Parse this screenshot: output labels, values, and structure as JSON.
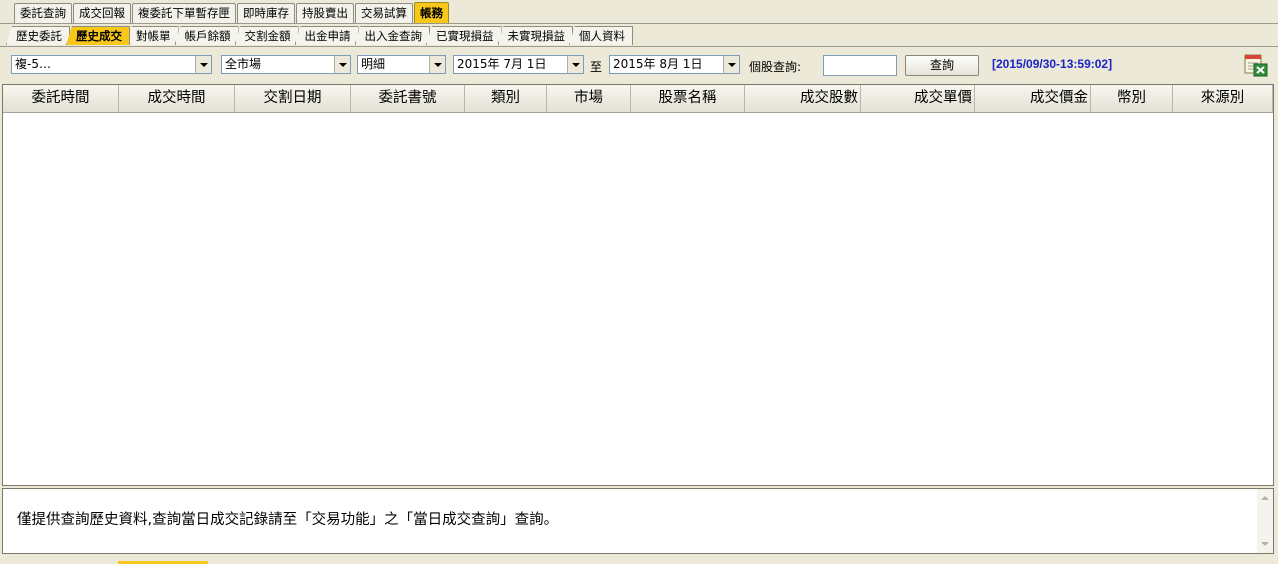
{
  "top_tabs": [
    {
      "label": "委託查詢",
      "active": false
    },
    {
      "label": "成交回報",
      "active": false
    },
    {
      "label": "複委託下單暫存匣",
      "active": false
    },
    {
      "label": "即時庫存",
      "active": false
    },
    {
      "label": "持股賣出",
      "active": false
    },
    {
      "label": "交易試算",
      "active": false
    },
    {
      "label": "帳務",
      "active": true
    }
  ],
  "sub_tabs": [
    {
      "label": "歷史委託",
      "active": false
    },
    {
      "label": "歷史成交",
      "active": true
    },
    {
      "label": "對帳單",
      "active": false
    },
    {
      "label": "帳戶餘額",
      "active": false
    },
    {
      "label": "交割金額",
      "active": false
    },
    {
      "label": "出金申請",
      "active": false
    },
    {
      "label": "出入金查詢",
      "active": false
    },
    {
      "label": "已實現損益",
      "active": false
    },
    {
      "label": "未實現損益",
      "active": false
    },
    {
      "label": "個人資料",
      "active": false
    }
  ],
  "toolbar": {
    "account_value": "複-5…",
    "market_value": "全市場",
    "detail_value": "明細",
    "start_date": "2015年  7月  1日",
    "to_label": "至",
    "end_date": "2015年  8月  1日",
    "stock_query_label": "個股查詢:",
    "stock_query_value": "",
    "query_button": "查詢",
    "timestamp": "[2015/09/30-13:59:02]"
  },
  "table": {
    "columns": [
      "委託時間",
      "成交時間",
      "交割日期",
      "委託書號",
      "類別",
      "市場",
      "股票名稱",
      "成交股數",
      "成交單價",
      "成交價金",
      "幣別",
      "來源別"
    ],
    "rows": []
  },
  "notice": "僅提供查詢歷史資料,查詢當日成交記錄請至「交易功能」之「當日成交查詢」查詢。",
  "colors": {
    "active_tab": "#f7c81a",
    "timestamp": "#1a22c8",
    "background": "#ece9d8"
  }
}
